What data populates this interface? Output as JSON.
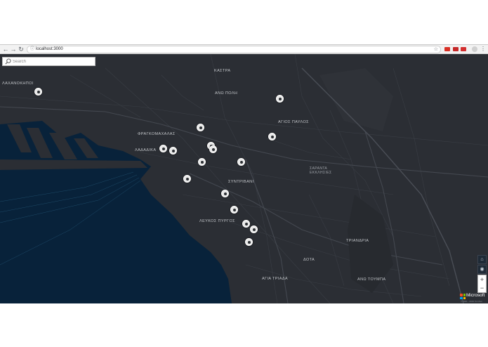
{
  "browser": {
    "url": "localhost:3000",
    "back_icon": "arrow-left-icon",
    "forward_icon": "arrow-right-icon",
    "reload_icon": "reload-icon",
    "menu_glyph": "⋮",
    "extension_colors": [
      "#d93025",
      "#c62828",
      "#d32f2f"
    ]
  },
  "search": {
    "placeholder": "Search"
  },
  "map": {
    "water_color": "#08223a",
    "land_color": "#2b2e34",
    "labels": {
      "kastra": "ΚΑΣΤΡΑ",
      "ano_poli": "ΑΝΩ ΠΟΛΗ",
      "kalamaria_west": "ΛΑΧΑΝΟΚΗΠΟΙ",
      "agios_pavlos": "ΑΓΙΟΣ ΠΑΥΛΟΣ",
      "fragkomachalas": "ΦΡΑΓΚΟΜΑΧΑΛΑΣ",
      "ladadika": "ΛΑΔΑΔΙΚΑ",
      "saranta_ekklisies": "ΣΑΡΑΝΤΑ ΕΚΚΛΗΣΙΕΣ",
      "syntrivani": "ΣΥΝΤΡΙΒΑΝΙ",
      "lefkos_pyrgos": "ΛΕΥΚΟΣ ΠΥΡΓΟΣ",
      "triandria": "ΤΡΙΑΝΔΡΙΑ",
      "dota": "ΔΟΤΑ",
      "agia_triada": "ΑΓΙΑ ΤΡΙΑΔΑ",
      "ano_toumpa": "ΑΝΩ ΤΟΥΜΠΑ"
    },
    "marker_count": 17
  },
  "controls": {
    "home_glyph": "⌂",
    "locate_glyph": "◉",
    "zoom_in": "+",
    "zoom_out": "−"
  },
  "attribution": {
    "brand": "Microsoft",
    "logo_colors": [
      "#f25022",
      "#7fba00",
      "#00a4ef",
      "#ffb900"
    ],
    "copyright": "© 2021 - 2019 TomTom"
  }
}
